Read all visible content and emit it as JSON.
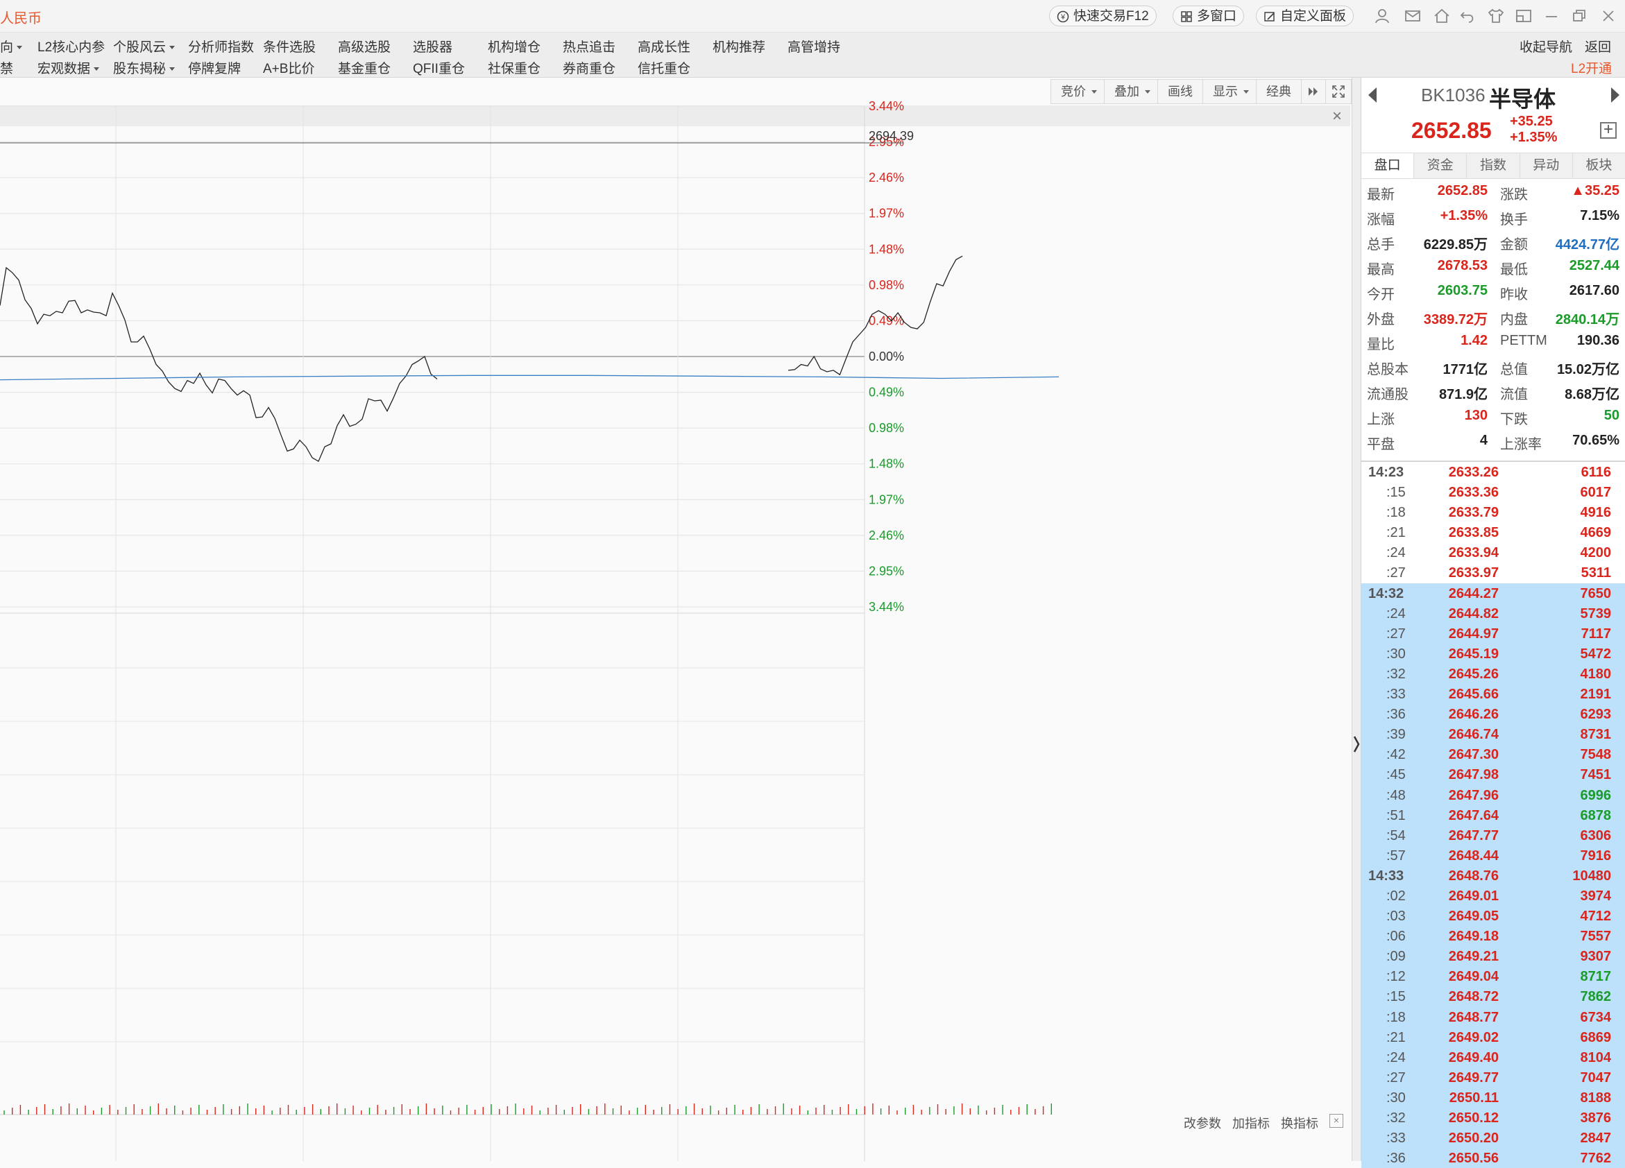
{
  "app": {
    "name": "人民币"
  },
  "titlebar": {
    "quick_trade": "快速交易F12",
    "multi_window": "多窗口",
    "custom_panel": "自定义面板"
  },
  "menu": {
    "row1": [
      "向",
      "L2核心内参",
      "个股风云",
      "分析师指数",
      "条件选股",
      "高级选股",
      "选股器",
      "机构增仓",
      "热点追击",
      "高成长性",
      "机构推荐",
      "高管增持"
    ],
    "row2": [
      "禁",
      "宏观数据",
      "股东揭秘",
      "停牌复牌",
      "A+B比价",
      "基金重仓",
      "QFII重仓",
      "社保重仓",
      "券商重仓",
      "信托重仓"
    ],
    "collapse_nav": "收起导航",
    "back": "返回",
    "l2_open": "L2开通"
  },
  "chart_toolbar": [
    "竞价",
    "叠加",
    "画线",
    "显示",
    "经典"
  ],
  "chart": {
    "current_value_label": "2694.39",
    "pct_labels": [
      "3.44%",
      "2.95%",
      "2.46%",
      "1.97%",
      "1.48%",
      "0.98%",
      "0.49%",
      "0.00%",
      "0.49%",
      "0.98%",
      "1.48%",
      "1.97%",
      "2.46%",
      "2.95%",
      "3.44%"
    ],
    "up_color": "#d9251c",
    "down_color": "#1a9b2a",
    "indicator_buttons": [
      "改参数",
      "加指标",
      "换指标"
    ]
  },
  "chart_data": {
    "type": "line",
    "prev_close": 2617.6,
    "ylim_pct": [
      -3.44,
      3.44
    ],
    "price_pct": [
      0.7,
      1.22,
      1.15,
      1.05,
      0.78,
      0.66,
      0.45,
      0.58,
      0.56,
      0.62,
      0.6,
      0.76,
      0.77,
      0.6,
      0.64,
      0.61,
      0.6,
      0.56,
      0.87,
      0.7,
      0.5,
      0.2,
      0.2,
      0.28,
      0.1,
      -0.11,
      -0.2,
      -0.35,
      -0.44,
      -0.48,
      -0.33,
      -0.37,
      -0.23,
      -0.39,
      -0.5,
      -0.31,
      -0.33,
      -0.44,
      -0.53,
      -0.47,
      -0.53,
      -0.84,
      -0.83,
      -0.7,
      -0.85,
      -1.08,
      -1.3,
      -1.27,
      -1.15,
      -1.24,
      -1.39,
      -1.44,
      -1.24,
      -1.2,
      -0.95,
      -0.8,
      -0.96,
      -0.93,
      -0.86,
      -0.58,
      -0.61,
      -0.6,
      -0.75,
      -0.57,
      -0.37,
      -0.27,
      -0.11,
      -0.06,
      0.0,
      -0.24,
      -0.31
    ],
    "price_pct_tail": [
      -0.19,
      -0.18,
      -0.11,
      -0.13,
      0.0,
      -0.17,
      -0.21,
      -0.19,
      -0.25,
      -0.02,
      0.2,
      0.3,
      0.4,
      0.58,
      0.63,
      0.58,
      0.49,
      0.6,
      0.47,
      0.4,
      0.38,
      0.47,
      0.75,
      1.0,
      0.97,
      1.17,
      1.33,
      1.38
    ],
    "avg_pct": [
      -0.32,
      -0.3,
      -0.28,
      -0.27,
      -0.26,
      -0.26,
      -0.27,
      -0.28,
      -0.3,
      -0.28
    ],
    "volume_bars": 130
  },
  "panel": {
    "code": "BK1036",
    "name": "半导体",
    "price": "2652.85",
    "change": "+35.25",
    "change_pct": "+1.35%",
    "tabs": [
      "盘口",
      "资金",
      "指数",
      "异动",
      "板块"
    ],
    "stats": [
      {
        "k1": "最新",
        "v1": "2652.85",
        "c1": "red",
        "k2": "涨跌",
        "v2": "▲35.25",
        "c2": "red"
      },
      {
        "k1": "涨幅",
        "v1": "+1.35%",
        "c1": "red",
        "k2": "换手",
        "v2": "7.15%",
        "c2": "dark"
      },
      {
        "k1": "总手",
        "v1": "6229.85万",
        "c1": "dark",
        "k2": "金额",
        "v2": "4424.77亿",
        "c2": "blue"
      },
      {
        "k1": "最高",
        "v1": "2678.53",
        "c1": "red",
        "k2": "最低",
        "v2": "2527.44",
        "c2": "green"
      },
      {
        "k1": "今开",
        "v1": "2603.75",
        "c1": "green",
        "k2": "昨收",
        "v2": "2617.60",
        "c2": "dark"
      },
      {
        "k1": "外盘",
        "v1": "3389.72万",
        "c1": "red",
        "k2": "内盘",
        "v2": "2840.14万",
        "c2": "green"
      },
      {
        "k1": "量比",
        "v1": "1.42",
        "c1": "red",
        "k2": "PETTM",
        "v2": "190.36",
        "c2": "dark"
      },
      {
        "k1": "总股本",
        "v1": "1771亿",
        "c1": "dark",
        "k2": "总值",
        "v2": "15.02万亿",
        "c2": "dark"
      },
      {
        "k1": "流通股",
        "v1": "871.9亿",
        "c1": "dark",
        "k2": "流值",
        "v2": "8.68万亿",
        "c2": "dark"
      },
      {
        "k1": "上涨",
        "v1": "130",
        "c1": "red",
        "k2": "下跌",
        "v2": "50",
        "c2": "green"
      },
      {
        "k1": "平盘",
        "v1": "4",
        "c1": "dark",
        "k2": "上涨率",
        "v2": "70.65%",
        "c2": "dark"
      }
    ],
    "ticks": [
      {
        "t": "14:23",
        "p": "2633.26",
        "v": "6116",
        "c": "red",
        "h": false,
        "s": false
      },
      {
        "t": ":15",
        "p": "2633.36",
        "v": "6017",
        "c": "red",
        "h": false,
        "s": true
      },
      {
        "t": ":18",
        "p": "2633.79",
        "v": "4916",
        "c": "red",
        "h": false,
        "s": true
      },
      {
        "t": ":21",
        "p": "2633.85",
        "v": "4669",
        "c": "red",
        "h": false,
        "s": true
      },
      {
        "t": ":24",
        "p": "2633.94",
        "v": "4200",
        "c": "red",
        "h": false,
        "s": true
      },
      {
        "t": ":27",
        "p": "2633.97",
        "v": "5311",
        "c": "red",
        "h": false,
        "s": true
      },
      {
        "t": "14:32",
        "p": "2644.27",
        "v": "7650",
        "c": "red",
        "h": true,
        "s": false
      },
      {
        "t": ":24",
        "p": "2644.82",
        "v": "5739",
        "c": "red",
        "h": true,
        "s": true
      },
      {
        "t": ":27",
        "p": "2644.97",
        "v": "7117",
        "c": "red",
        "h": true,
        "s": true
      },
      {
        "t": ":30",
        "p": "2645.19",
        "v": "5472",
        "c": "red",
        "h": true,
        "s": true
      },
      {
        "t": ":32",
        "p": "2645.26",
        "v": "4180",
        "c": "red",
        "h": true,
        "s": true
      },
      {
        "t": ":33",
        "p": "2645.66",
        "v": "2191",
        "c": "red",
        "h": true,
        "s": true
      },
      {
        "t": ":36",
        "p": "2646.26",
        "v": "6293",
        "c": "red",
        "h": true,
        "s": true
      },
      {
        "t": ":39",
        "p": "2646.74",
        "v": "8731",
        "c": "red",
        "h": true,
        "s": true
      },
      {
        "t": ":42",
        "p": "2647.30",
        "v": "7548",
        "c": "red",
        "h": true,
        "s": true
      },
      {
        "t": ":45",
        "p": "2647.98",
        "v": "7451",
        "c": "red",
        "h": true,
        "s": true
      },
      {
        "t": ":48",
        "p": "2647.96",
        "v": "6996",
        "c": "green",
        "h": true,
        "s": true
      },
      {
        "t": ":51",
        "p": "2647.64",
        "v": "6878",
        "c": "green",
        "h": true,
        "s": true
      },
      {
        "t": ":54",
        "p": "2647.77",
        "v": "6306",
        "c": "red",
        "h": true,
        "s": true
      },
      {
        "t": ":57",
        "p": "2648.44",
        "v": "7916",
        "c": "red",
        "h": true,
        "s": true
      },
      {
        "t": "14:33",
        "p": "2648.76",
        "v": "10480",
        "c": "red",
        "h": true,
        "s": false
      },
      {
        "t": ":02",
        "p": "2649.01",
        "v": "3974",
        "c": "red",
        "h": true,
        "s": true
      },
      {
        "t": ":03",
        "p": "2649.05",
        "v": "4712",
        "c": "red",
        "h": true,
        "s": true
      },
      {
        "t": ":06",
        "p": "2649.18",
        "v": "7557",
        "c": "red",
        "h": true,
        "s": true
      },
      {
        "t": ":09",
        "p": "2649.21",
        "v": "9307",
        "c": "red",
        "h": true,
        "s": true
      },
      {
        "t": ":12",
        "p": "2649.04",
        "v": "8717",
        "c": "green",
        "h": true,
        "s": true
      },
      {
        "t": ":15",
        "p": "2648.72",
        "v": "7862",
        "c": "green",
        "h": true,
        "s": true
      },
      {
        "t": ":18",
        "p": "2648.77",
        "v": "6734",
        "c": "red",
        "h": true,
        "s": true
      },
      {
        "t": ":21",
        "p": "2649.02",
        "v": "6869",
        "c": "red",
        "h": true,
        "s": true
      },
      {
        "t": ":24",
        "p": "2649.40",
        "v": "8104",
        "c": "red",
        "h": true,
        "s": true
      },
      {
        "t": ":27",
        "p": "2649.77",
        "v": "7047",
        "c": "red",
        "h": true,
        "s": true
      },
      {
        "t": ":30",
        "p": "2650.11",
        "v": "8188",
        "c": "red",
        "h": true,
        "s": true
      },
      {
        "t": ":32",
        "p": "2650.12",
        "v": "3876",
        "c": "red",
        "h": true,
        "s": true
      },
      {
        "t": ":33",
        "p": "2650.20",
        "v": "2847",
        "c": "red",
        "h": true,
        "s": true
      },
      {
        "t": ":36",
        "p": "2650.56",
        "v": "7762",
        "c": "red",
        "h": true,
        "s": true
      }
    ]
  }
}
